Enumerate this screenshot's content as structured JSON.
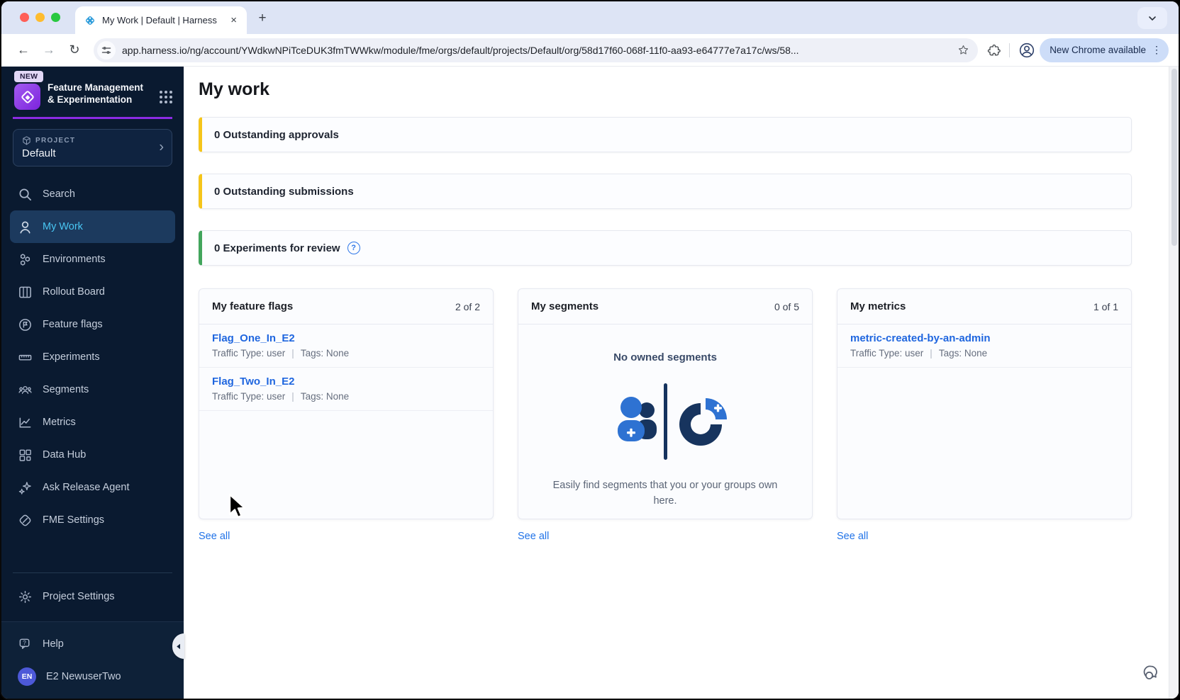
{
  "colors": {
    "accent_yellow": "#F5C51A",
    "accent_green": "#42A55C",
    "sidebar_bg": "#0A1A30",
    "selected_nav_bg": "#1C3A5E",
    "selected_nav_text": "#49C6F3",
    "link_blue": "#1F66DF",
    "brand_purple": "#8B2BE2",
    "traffic_red": "#FF5F57",
    "traffic_yellow": "#FEBC2E",
    "traffic_green": "#28C840"
  },
  "browser": {
    "tab_title": "My Work | Default | Harness",
    "close_glyph": "×",
    "newtab_glyph": "+",
    "back_glyph": "←",
    "forward_glyph": "→",
    "reload_glyph": "↻",
    "chevron_glyph": "⌄",
    "url": "app.harness.io/ng/account/YWdkwNPiTceDUK3fmTWWkw/module/fme/orgs/default/projects/Default/org/58d17f60-068f-11f0-aa93-e64777e7a17c/ws/58...",
    "update_button": "New Chrome available",
    "kebab_glyph": "⋮"
  },
  "sidebar": {
    "badge": "NEW",
    "product": "Feature Management & Experimentation",
    "project_label": "PROJECT",
    "project_name": "Default",
    "project_chevron": "›",
    "nav": [
      {
        "label": "Search",
        "icon": "search-icon"
      },
      {
        "label": "My Work",
        "icon": "user-icon"
      },
      {
        "label": "Environments",
        "icon": "environments-icon"
      },
      {
        "label": "Rollout Board",
        "icon": "rollout-board-icon"
      },
      {
        "label": "Feature flags",
        "icon": "feature-flags-icon"
      },
      {
        "label": "Experiments",
        "icon": "experiments-icon"
      },
      {
        "label": "Segments",
        "icon": "segments-icon"
      },
      {
        "label": "Metrics",
        "icon": "metrics-icon"
      },
      {
        "label": "Data Hub",
        "icon": "data-hub-icon"
      },
      {
        "label": "Ask Release Agent",
        "icon": "sparkles-icon"
      },
      {
        "label": "FME Settings",
        "icon": "fme-settings-icon"
      }
    ],
    "settings_label": "Project Settings",
    "help_label": "Help",
    "user_initials": "EN",
    "user_name": "E2 NewuserTwo"
  },
  "main": {
    "title": "My work",
    "banners": [
      {
        "text": "0 Outstanding approvals",
        "accent": "#F5C51A"
      },
      {
        "text": "0 Outstanding submissions",
        "accent": "#F5C51A"
      },
      {
        "text": "0 Experiments for review",
        "accent": "#42A55C",
        "help_glyph": "?"
      }
    ],
    "meta_separator": "|",
    "see_all": "See all",
    "cards": [
      {
        "title": "My feature flags",
        "count": "2 of 2",
        "items": [
          {
            "name": "Flag_One_In_E2",
            "traffic": "Traffic Type: user",
            "tags": "Tags: None"
          },
          {
            "name": "Flag_Two_In_E2",
            "traffic": "Traffic Type: user",
            "tags": "Tags: None"
          }
        ]
      },
      {
        "title": "My segments",
        "count": "0 of 5",
        "empty_title": "No owned segments",
        "empty_caption": "Easily find segments that you or your groups own here."
      },
      {
        "title": "My metrics",
        "count": "1 of 1",
        "items": [
          {
            "name": "metric-created-by-an-admin",
            "traffic": "Traffic Type: user",
            "tags": "Tags: None"
          }
        ]
      }
    ]
  }
}
